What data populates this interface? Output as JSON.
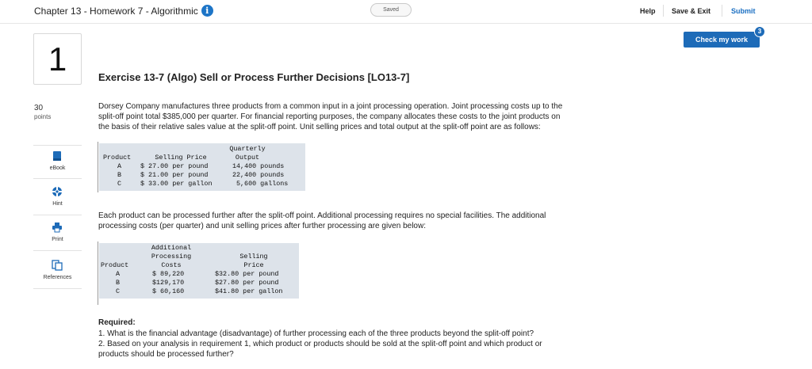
{
  "header": {
    "title": "Chapter 13 - Homework 7 - Algorithmic",
    "info_icon": "info-icon",
    "saved_label": "Saved",
    "help_label": "Help",
    "save_exit_label": "Save & Exit",
    "submit_label": "Submit"
  },
  "check_work": {
    "label": "Check my work",
    "badge": "3"
  },
  "question": {
    "number": "1",
    "points_value": "30",
    "points_label": "points"
  },
  "tools": [
    {
      "label": "eBook",
      "icon": "book-icon"
    },
    {
      "label": "Hint",
      "icon": "lifebuoy-icon"
    },
    {
      "label": "Print",
      "icon": "printer-icon"
    },
    {
      "label": "References",
      "icon": "documents-icon"
    }
  ],
  "exercise": {
    "title": "Exercise 13-7 (Algo) Sell or Process Further Decisions [LO13-7]",
    "intro_lines": [
      "Dorsey Company manufactures three products from a common input in a joint processing operation. Joint processing costs up to the",
      "split-off point total $385,000 per quarter. For financial reporting purposes, the company allocates these costs to the joint products on",
      "the basis of their relative sales value at the split-off point. Unit selling prices and total output at the split-off point are as follows:"
    ],
    "table1": {
      "headers": {
        "product": "Product",
        "selling_price": "Selling Price",
        "output_line1": "Quarterly",
        "output_line2": "Output"
      },
      "rows": [
        {
          "product": "A",
          "price": "$ 27.00 per pound",
          "output": "14,400 pounds"
        },
        {
          "product": "B",
          "price": "$ 21.00 per pound",
          "output": "22,400 pounds"
        },
        {
          "product": "C",
          "price": "$ 33.00 per gallon",
          "output": "5,600 gallons"
        }
      ]
    },
    "para2_lines": [
      "Each product can be processed further after the split-off point. Additional processing requires no special facilities. The additional",
      "processing costs (per quarter) and unit selling prices after further processing are given below:"
    ],
    "table2": {
      "headers": {
        "product": "Product",
        "cost_line1": "Additional",
        "cost_line2": "Processing",
        "cost_line3": "Costs",
        "price_line1": "Selling",
        "price_line2": "Price"
      },
      "rows": [
        {
          "product": "A",
          "cost": "$ 89,220",
          "price": "$32.80 per pound"
        },
        {
          "product": "B",
          "cost": "$129,170",
          "price": "$27.80 per pound"
        },
        {
          "product": "C",
          "cost": "$ 60,160",
          "price": "$41.80 per gallon"
        }
      ]
    },
    "required_label": "Required:",
    "required_lines": [
      "1. What is the financial advantage (disadvantage) of further processing each of the three products beyond the split-off point?",
      "2. Based on your analysis in requirement 1, which product or products should be sold at the split-off point and which product or",
      "products should be processed further?"
    ]
  },
  "colors": {
    "accent": "#1d6bb8",
    "table_bg": "#dde3ea"
  }
}
